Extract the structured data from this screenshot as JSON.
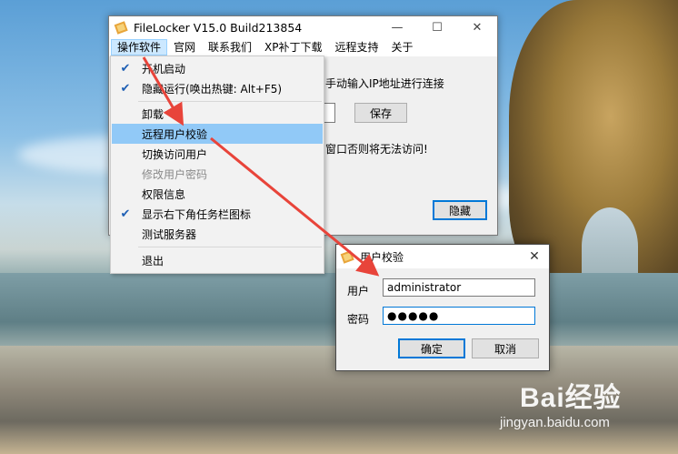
{
  "main_window": {
    "title": "FileLocker V15.0 Build213854",
    "menu": [
      "操作软件",
      "官网",
      "联系我们",
      "XP补丁下载",
      "远程支持",
      "关于"
    ],
    "hint_text": "手动输入IP地址进行连接",
    "save_label": "保存",
    "warn_text": "窗口否则将无法访问!",
    "hide_label": "隐藏"
  },
  "dropdown": {
    "items": [
      {
        "label": "开机启动",
        "checked": true
      },
      {
        "label": "隐藏运行(唤出热键: Alt+F5)",
        "checked": true
      },
      {
        "label": "卸载",
        "checked": false
      },
      {
        "label": "远程用户校验",
        "checked": false,
        "highlighted": true
      },
      {
        "label": "切换访问用户",
        "checked": false
      },
      {
        "label": "修改用户密码",
        "checked": false,
        "disabled": true
      },
      {
        "label": "权限信息",
        "checked": false
      },
      {
        "label": "显示右下角任务栏图标",
        "checked": true
      },
      {
        "label": "测试服务器",
        "checked": false
      },
      {
        "label": "退出",
        "checked": false
      }
    ]
  },
  "dialog": {
    "title": "用户校验",
    "user_label": "用户",
    "user_value": "administrator",
    "password_label": "密码",
    "password_value": "●●●●●",
    "ok_label": "确定",
    "cancel_label": "取消"
  },
  "watermark": {
    "logo": "Bai经验",
    "url": "jingyan.baidu.com"
  },
  "colors": {
    "highlight": "#91c9f7",
    "arrow": "#e8443a",
    "check": "#1e5fb4"
  }
}
